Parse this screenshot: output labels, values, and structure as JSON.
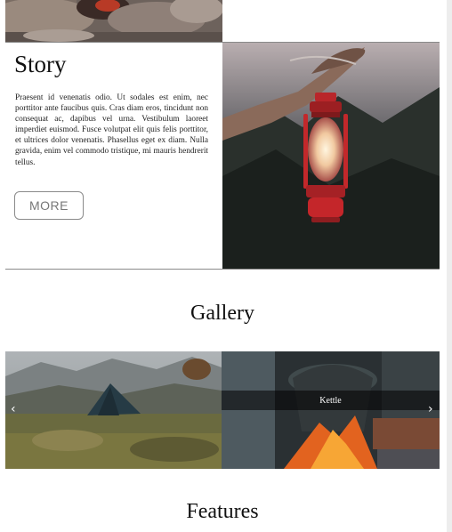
{
  "story": {
    "title": "Story",
    "body": "Praesent id venenatis odio. Ut sodales est enim, nec porttitor ante faucibus quis. Cras diam eros, tincidunt non consequat ac, dapibus vel urna. Vestibulum laoreet imperdiet euismod. Fusce volutpat elit quis felis porttitor, et ultrices dolor venenatis. Phasellus eget ex diam. Nulla gravida, enim vel commodo tristique, mi mauris hendrerit tellus.",
    "more_label": "MORE"
  },
  "gallery": {
    "title": "Gallery",
    "caption": "Kettle",
    "prev_glyph": "‹",
    "next_glyph": "›"
  },
  "features": {
    "title": "Features"
  },
  "icons": {
    "prev": "chevron-left-icon",
    "next": "chevron-right-icon"
  }
}
